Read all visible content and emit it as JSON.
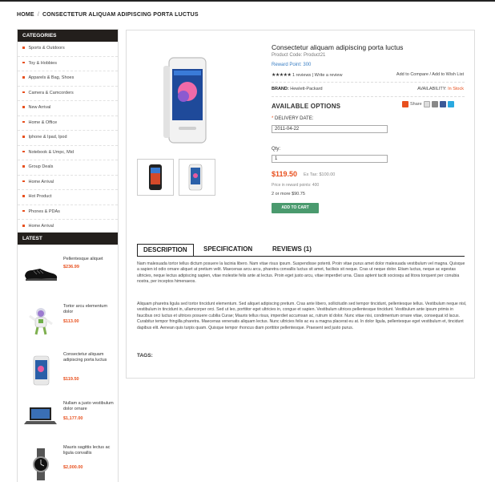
{
  "breadcrumb": {
    "home": "HOME",
    "sep": "/",
    "current": "CONSECTETUR ALIQUAM ADIPISCING PORTA LUCTUS"
  },
  "categories": {
    "title": "CATEGORIES",
    "items": [
      "Sports & Outdoors",
      "Toy & Hobbies",
      "Apparels & Bag, Shoes",
      "Camera & Camcorders",
      "New Arrival",
      "Home & Office",
      "Iphone & Ipad, Ipod",
      "Notebook & Umpc, Mid",
      "Group Deals",
      "Home Arrival",
      "Hot Product",
      "Phones & PDAs",
      "Home Arrival"
    ]
  },
  "latest": {
    "title": "LATEST",
    "items": [
      {
        "name": "Pellentesque aliquet",
        "price": "$236.99"
      },
      {
        "name": "Tortor arcu elementum dolor",
        "price": "$113.00"
      },
      {
        "name": "Consectetur aliquam adipiscing porta luctus",
        "price": "$119.50"
      },
      {
        "name": "Nullam a justo vestibulum dolor ornare",
        "price": "$1,177.00"
      },
      {
        "name": "Mauris sagittis lectus ac ligula convallis",
        "price": "$2,000.00"
      }
    ]
  },
  "product": {
    "title": "Consectetur aliquam adipiscing porta luctus",
    "code": "Product Code: Product21",
    "reward_points": "Reward Point: 300",
    "stars": "★★★★★",
    "reviews": "1 reviews",
    "write_review": "Write a review",
    "compare": "Add to Compare",
    "wishlist": "Add to Wish List",
    "brand_label": "BRAND:",
    "brand": "Hewlett-Packard",
    "availability_label": "AVAILABILITY:",
    "availability": "In Stock",
    "options_title": "AVAILABLE OPTIONS",
    "share": "Share",
    "delivery_label": "DELIVERY DATE:",
    "delivery_value": "2011-04-22",
    "qty_label": "Qty:",
    "qty_value": "1",
    "price": "$119.50",
    "ex_tax": "Ex Tax: $100.00",
    "price_reward": "Price in reward points: 400",
    "discount": "2 or more $90.75",
    "cart_button": "ADD TO CART"
  },
  "tabs": [
    "DESCRIPTION",
    "SPECIFICATION",
    "REVIEWS (1)"
  ],
  "description": {
    "p1": "Nam malesuada tortor tellus dictum posuere la lacinia libero. Nam vitae risus ipsum. Suspendisse potenti. Proin vitae purus amet dolor malesuada vestibulum vel magna. Quisque a sapien id odio ornare aliquet at pretium velit. Maecenas arcu arcu, pharetra convallis luctus sit amet, facilisis sit neque. Cras ut neque dolor. Etiam luctus, neque ac egestas ultricies, neque lectus adipiscing sapien, vitae molestie felis ante at lectus. Proin eget justo arcu, vitae imperdiet urna. Class aptent taciti sociosqu ad litora torquent per conubia nostra, per inceptos himenaeos.",
    "p2": "Aliquam pharetra ligula sed tortor tincidunt elementum. Sed aliquet adipiscing pretium. Cras ante libero, sollicitudin sed tempor tincidunt, pellentesque tellus. Vestibulum neque nisl, vestibulum in tincidunt in, ullamcorper orci. Sed ut leo, porttitor eget ultricies in, congue et sapien. Vestibulum ultrices pellentesque tincidunt. Vestibulum ante ipsum primis in faucibus orci luctus et ultrices posuere cubilia Curae; Mauris tellus risus, imperdiet accumsan ac, rutrum id dolor. Nunc vitae nisi, condimentum ornare vitae, consequat id lacus. Curabitur tempor fringilla pharetra. Maecenas venenatis aliquam lectus. Nunc ultricies felis ac eu a magna placerat eu at. In dolor ligula, pellentesque eget vestibulum et, tincidunt dapibus elit. Aenean quis turpis quam. Quisque tempor rhoncus diam porttitor pellentesque. Praesent sed justo purus.",
    "tags_label": "TAGS:"
  },
  "colors": {
    "accent": "#e8501e",
    "header_bg": "#231f1c",
    "cart_btn": "#4a9a6e",
    "link": "#3a7fc4"
  }
}
